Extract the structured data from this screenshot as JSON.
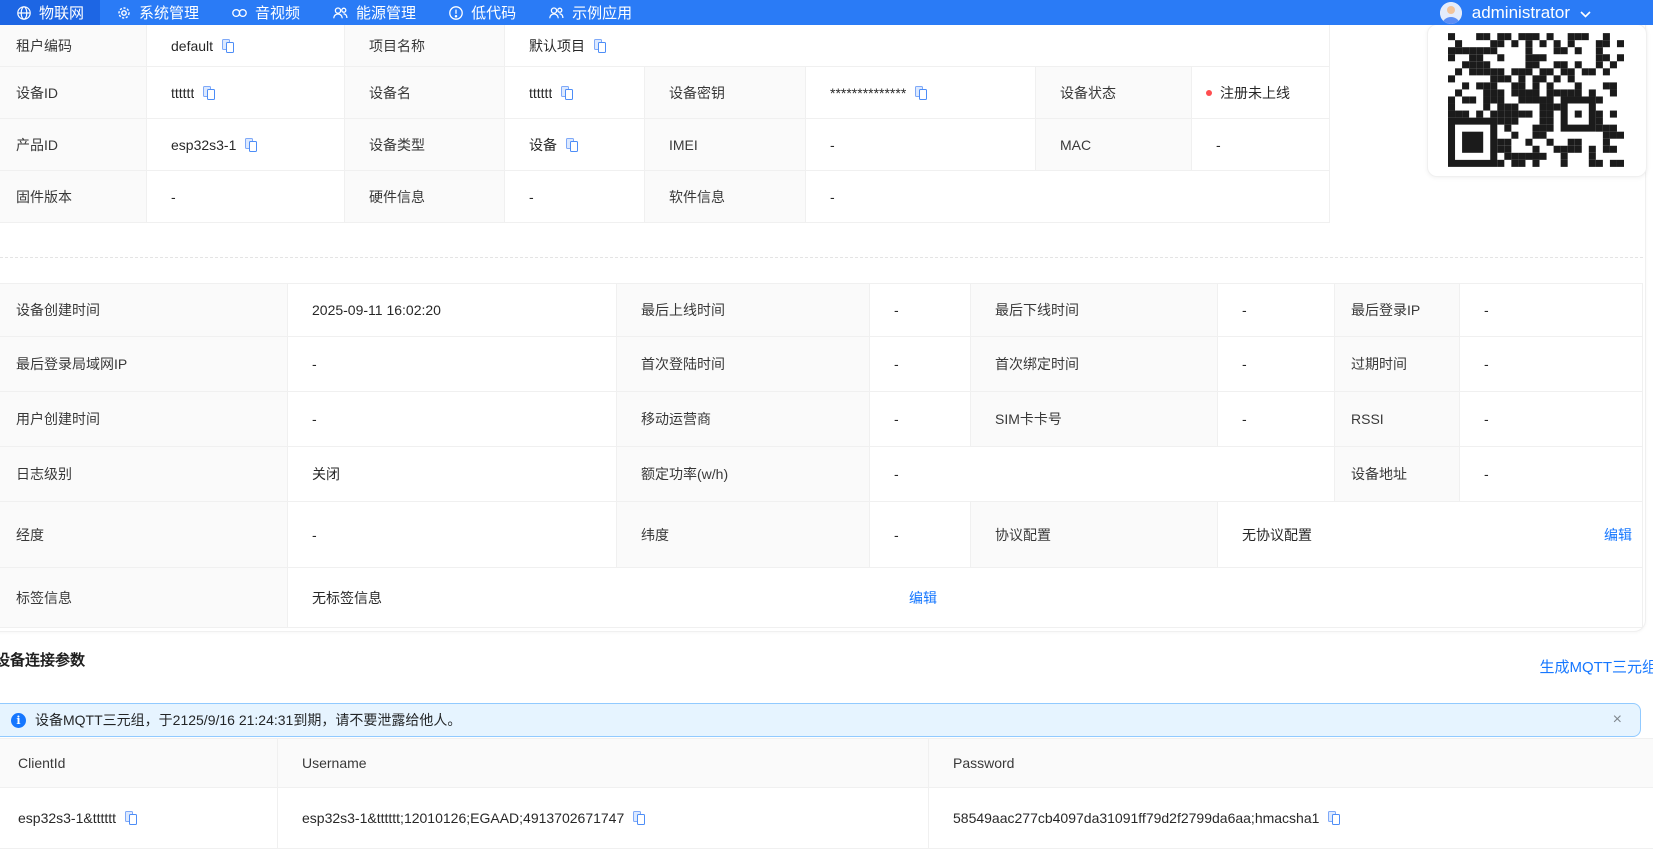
{
  "colors": {
    "nav_bg": "#2a7bf6",
    "nav_active_bg": "#1d66e4",
    "link_blue": "#1677ff",
    "banner_bg": "#e6f4ff",
    "banner_border": "#91caff",
    "status_red": "#ff4d4f",
    "label_cell_bg": "#fafafa"
  },
  "nav": {
    "items": [
      {
        "label": "物联网",
        "icon": "iot-globe-icon",
        "active": true
      },
      {
        "label": "系统管理",
        "icon": "gear-icon",
        "active": false
      },
      {
        "label": "音视频",
        "icon": "audio-video-icon",
        "active": false
      },
      {
        "label": "能源管理",
        "icon": "energy-users-icon",
        "active": false
      },
      {
        "label": "低代码",
        "icon": "lowcode-icon",
        "active": false
      },
      {
        "label": "示例应用",
        "icon": "apps-users-icon",
        "active": false
      }
    ],
    "user": {
      "name": "administrator"
    }
  },
  "basic": {
    "rows": [
      {
        "cells": [
          {
            "text": "租户编码"
          },
          {
            "text": "default",
            "copy": true
          },
          {
            "text": "项目名称"
          },
          {
            "text": "默认项目",
            "copy": true
          }
        ]
      },
      {
        "cells": [
          {
            "text": "设备ID"
          },
          {
            "text": "tttttt",
            "copy": true
          },
          {
            "text": "设备名"
          },
          {
            "text": "tttttt",
            "copy": true
          },
          {
            "text": "设备密钥"
          },
          {
            "text": "**************",
            "copy": true
          },
          {
            "text": "设备状态"
          },
          {
            "text": "注册未上线",
            "status_dot": "#ff4d4f"
          }
        ]
      },
      {
        "cells": [
          {
            "text": "产品ID"
          },
          {
            "text": "esp32s3-1",
            "copy": true
          },
          {
            "text": "设备类型"
          },
          {
            "text": "设备",
            "copy": true
          },
          {
            "text": "IMEI"
          },
          {
            "text": "-"
          },
          {
            "text": "MAC"
          },
          {
            "text": "-"
          }
        ]
      },
      {
        "cells": [
          {
            "text": "固件版本"
          },
          {
            "text": "-"
          },
          {
            "text": "硬件信息"
          },
          {
            "text": "-"
          },
          {
            "text": "软件信息"
          },
          {
            "text": "-"
          }
        ]
      }
    ]
  },
  "detail": {
    "rows": [
      {
        "cells": [
          {
            "text": "设备创建时间"
          },
          {
            "text": "2025-09-11 16:02:20"
          },
          {
            "text": "最后上线时间"
          },
          {
            "text": "-"
          },
          {
            "text": "最后下线时间"
          },
          {
            "text": "-"
          },
          {
            "text": "最后登录IP"
          },
          {
            "text": "-"
          }
        ]
      },
      {
        "cells": [
          {
            "text": "最后登录局域网IP"
          },
          {
            "text": "-"
          },
          {
            "text": "首次登陆时间"
          },
          {
            "text": "-"
          },
          {
            "text": "首次绑定时间"
          },
          {
            "text": "-"
          },
          {
            "text": "过期时间"
          },
          {
            "text": "-"
          }
        ]
      },
      {
        "cells": [
          {
            "text": "用户创建时间"
          },
          {
            "text": "-"
          },
          {
            "text": "移动运营商"
          },
          {
            "text": "-"
          },
          {
            "text": "SIM卡卡号"
          },
          {
            "text": "-"
          },
          {
            "text": "RSSI"
          },
          {
            "text": "-"
          }
        ]
      },
      {
        "cells": [
          {
            "text": "日志级别"
          },
          {
            "text": "关闭"
          },
          {
            "text": "额定功率(w/h)"
          },
          {
            "text": "-"
          },
          {
            "text": "设备地址"
          },
          {
            "text": "-"
          }
        ]
      },
      {
        "cells": [
          {
            "text": "经度"
          },
          {
            "text": "-"
          },
          {
            "text": "纬度"
          },
          {
            "text": "-"
          },
          {
            "text": "协议配置"
          },
          {
            "text": "无协议配置",
            "action": "编辑"
          }
        ]
      },
      {
        "cells": [
          {
            "text": "标签信息"
          },
          {
            "text": "无标签信息",
            "action": "编辑"
          }
        ]
      }
    ]
  },
  "connection": {
    "title": "设备连接参数",
    "generate_link": "生成MQTT三元组",
    "banner": {
      "text": "设备MQTT三元组，于2125/9/16 21:24:31到期，请不要泄露给他人。",
      "close": "×"
    },
    "table": {
      "headers": [
        "ClientId",
        "Username",
        "Password"
      ],
      "row": [
        {
          "text": "esp32s3-1&tttttt",
          "copy": true
        },
        {
          "text": "esp32s3-1&tttttt;12010126;EGAAD;4913702671747",
          "copy": true
        },
        {
          "text": "58549aac277cb4097da31091ff79d2f2799da6aa;hmacsha1",
          "copy": true
        }
      ]
    }
  }
}
